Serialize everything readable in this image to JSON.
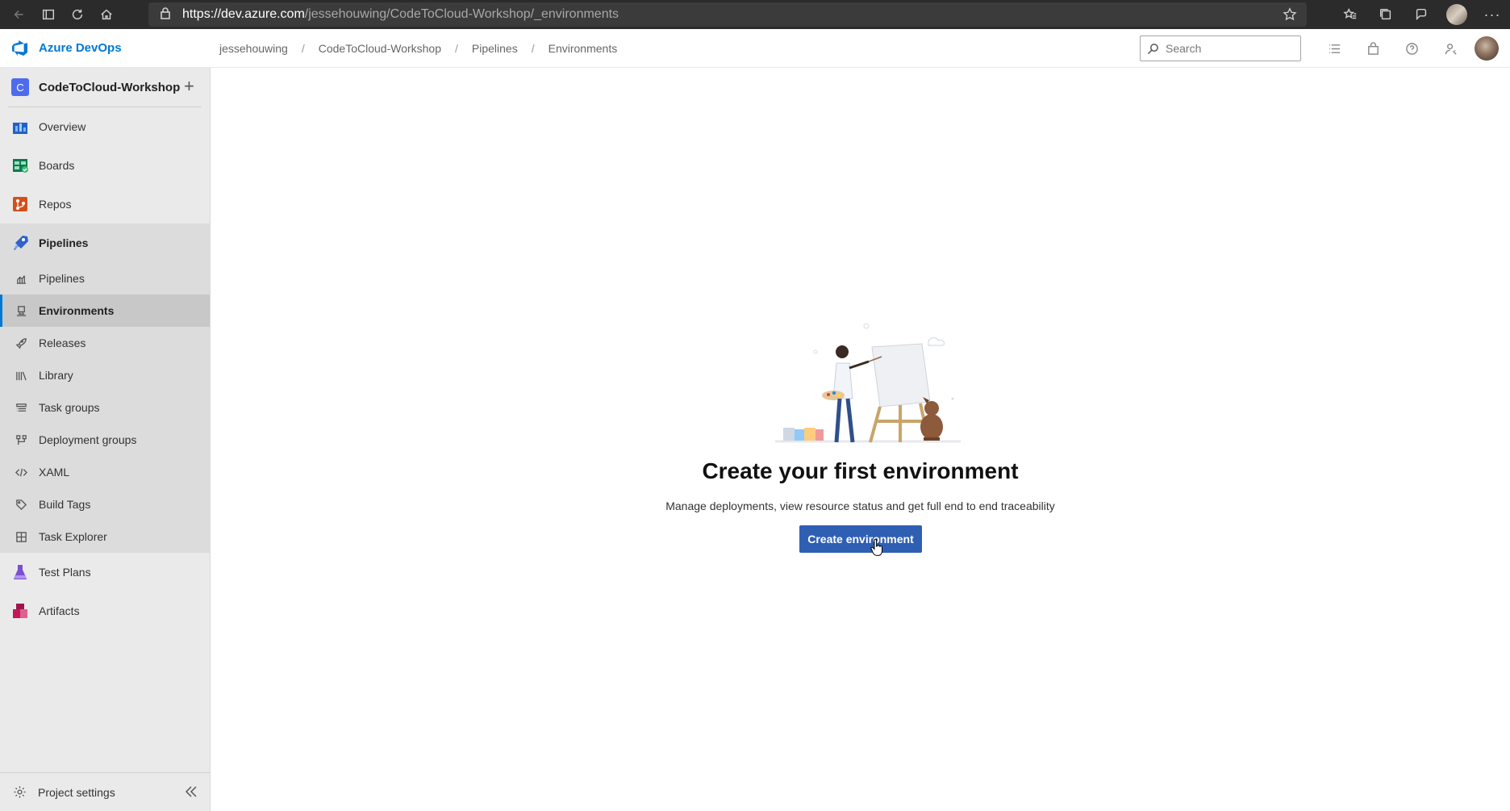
{
  "browser": {
    "url_host": "https://dev.azure.com",
    "url_path": "/jessehouwing/CodeToCloud-Workshop/_environments"
  },
  "topnav": {
    "brand": "Azure DevOps",
    "breadcrumb": [
      "jessehouwing",
      "CodeToCloud-Workshop",
      "Pipelines",
      "Environments"
    ],
    "search_placeholder": "Search"
  },
  "sidebar": {
    "project_initial": "C",
    "project_name": "CodeToCloud-Workshop",
    "items": [
      {
        "label": "Overview",
        "icon": "overview-icon"
      },
      {
        "label": "Boards",
        "icon": "boards-icon"
      },
      {
        "label": "Repos",
        "icon": "repos-icon"
      }
    ],
    "pipelines_group": {
      "label": "Pipelines",
      "sub": [
        "Pipelines",
        "Environments",
        "Releases",
        "Library",
        "Task groups",
        "Deployment groups",
        "XAML",
        "Build Tags",
        "Task Explorer"
      ],
      "selected": "Environments"
    },
    "items_after": [
      {
        "label": "Test Plans",
        "icon": "test-plans-icon"
      },
      {
        "label": "Artifacts",
        "icon": "artifacts-icon"
      }
    ],
    "footer": "Project settings"
  },
  "main": {
    "headline": "Create your first environment",
    "subline": "Manage deployments, view resource status and get full end to end traceability",
    "cta": "Create environment"
  },
  "colors": {
    "accent": "#0078d4",
    "button": "#2f5fb3",
    "project_badge": "#4f6bed"
  }
}
